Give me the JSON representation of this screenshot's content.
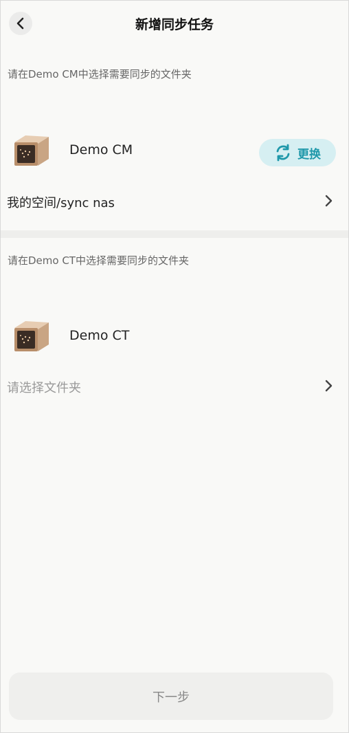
{
  "header": {
    "title": "新增同步任务",
    "back_icon": "chevron-left-icon"
  },
  "source": {
    "hint": "请在Demo CM中选择需要同步的文件夹",
    "device_name": "Demo CM",
    "device_icon": "nas-device-icon",
    "change_label": "更换",
    "change_icon": "refresh-icon",
    "path": "我的空间/sync nas"
  },
  "target": {
    "hint": "请在Demo CT中选择需要同步的文件夹",
    "device_name": "Demo CT",
    "device_icon": "nas-device-icon",
    "path_placeholder": "请选择文件夹"
  },
  "footer": {
    "next_label": "下一步"
  },
  "colors": {
    "accent": "#1f98aa",
    "accent_bg": "#d6eff2",
    "background": "#f9f9f7"
  }
}
